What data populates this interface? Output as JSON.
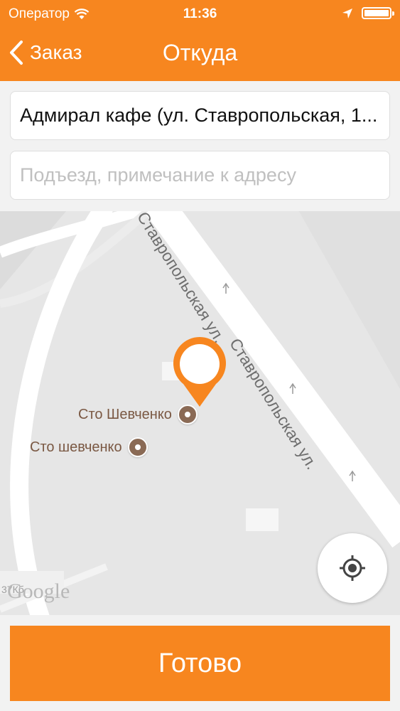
{
  "status_bar": {
    "carrier": "Оператор",
    "time": "11:36"
  },
  "nav": {
    "back_label": "Заказ",
    "title": "Откуда"
  },
  "form": {
    "address_value": "Адмирал кафе (ул. Ставропольская, 1...",
    "note_placeholder": "Подъезд, примечание к адресу",
    "note_value": ""
  },
  "map": {
    "streets": [
      {
        "label": "Ставропольская ул."
      },
      {
        "label": "Ставропольская ул."
      }
    ],
    "pois": [
      {
        "label": "Сто Шевченко"
      },
      {
        "label": "Сто шевченко"
      }
    ],
    "watermark": "Google",
    "scale_text": "37Кб"
  },
  "actions": {
    "done_label": "Готово"
  },
  "colors": {
    "accent": "#f7861f",
    "poi": "#8a6a55",
    "map_bg": "#e6e6e6",
    "road": "#ffffff"
  }
}
